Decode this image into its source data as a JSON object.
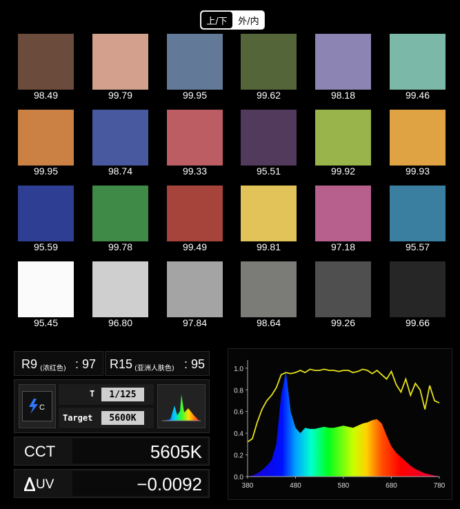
{
  "toggle": {
    "option1": "上/下",
    "option2": "外/内"
  },
  "swatches": [
    {
      "color": "#6a4b3c",
      "value": "98.49"
    },
    {
      "color": "#d4a08e",
      "value": "99.79"
    },
    {
      "color": "#627a98",
      "value": "99.95"
    },
    {
      "color": "#55653a",
      "value": "99.62"
    },
    {
      "color": "#8c84b2",
      "value": "98.18"
    },
    {
      "color": "#7cb8a8",
      "value": "99.46"
    },
    {
      "color": "#cb8143",
      "value": "99.95"
    },
    {
      "color": "#4959a0",
      "value": "98.74"
    },
    {
      "color": "#bc5d64",
      "value": "99.33"
    },
    {
      "color": "#523a5d",
      "value": "95.51"
    },
    {
      "color": "#98b44b",
      "value": "99.92"
    },
    {
      "color": "#e0a343",
      "value": "99.93"
    },
    {
      "color": "#2e3e92",
      "value": "95.59"
    },
    {
      "color": "#3f8a46",
      "value": "99.78"
    },
    {
      "color": "#a6433b",
      "value": "99.49"
    },
    {
      "color": "#e2c35a",
      "value": "99.81"
    },
    {
      "color": "#b7608e",
      "value": "97.18"
    },
    {
      "color": "#3a7ea0",
      "value": "95.57"
    },
    {
      "color": "#fbfbfb",
      "value": "95.45"
    },
    {
      "color": "#cfcfcf",
      "value": "96.80"
    },
    {
      "color": "#a4a4a4",
      "value": "97.84"
    },
    {
      "color": "#7b7b78",
      "value": "98.64"
    },
    {
      "color": "#4f4f4f",
      "value": "99.26"
    },
    {
      "color": "#262626",
      "value": "99.66"
    }
  ],
  "metrics": {
    "r9_label": "R9",
    "r9_sub": "(浓红色)",
    "r9_value": ": 97",
    "r15_label": "R15",
    "r15_sub": "(亚洲人肤色)",
    "r15_value": ": 95",
    "t_label": "T",
    "t_value": "1/125",
    "target_label": "Target",
    "target_value": "5600K",
    "cct_label": "CCT",
    "cct_value": "5605K",
    "duv_label": "UV",
    "duv_value": "−0.0092",
    "flash_letter": "C"
  },
  "chart_data": {
    "type": "line",
    "x": [
      380,
      390,
      400,
      410,
      420,
      430,
      440,
      450,
      460,
      470,
      480,
      490,
      500,
      510,
      520,
      530,
      540,
      550,
      560,
      570,
      580,
      590,
      600,
      610,
      620,
      630,
      640,
      650,
      660,
      670,
      680,
      690,
      700,
      710,
      720,
      730,
      740,
      750,
      760,
      770,
      780
    ],
    "series": [
      {
        "values": [
          0.32,
          0.35,
          0.5,
          0.62,
          0.7,
          0.75,
          0.82,
          0.94,
          0.96,
          0.95,
          0.96,
          0.98,
          0.96,
          0.99,
          0.98,
          0.98,
          0.99,
          0.98,
          0.98,
          0.97,
          0.98,
          0.98,
          0.96,
          0.97,
          0.99,
          0.98,
          0.95,
          0.98,
          0.94,
          0.9,
          0.97,
          0.85,
          0.78,
          0.9,
          0.75,
          0.86,
          0.8,
          0.62,
          0.84,
          0.7,
          0.68
        ]
      },
      {
        "values": [
          0.0,
          0.01,
          0.03,
          0.06,
          0.1,
          0.15,
          0.3,
          0.75,
          0.97,
          0.6,
          0.45,
          0.4,
          0.45,
          0.44,
          0.44,
          0.45,
          0.46,
          0.45,
          0.45,
          0.46,
          0.47,
          0.46,
          0.45,
          0.47,
          0.49,
          0.5,
          0.52,
          0.53,
          0.49,
          0.38,
          0.28,
          0.22,
          0.18,
          0.14,
          0.1,
          0.07,
          0.05,
          0.03,
          0.02,
          0.01,
          0.0
        ]
      }
    ],
    "xticks": [
      380,
      480,
      580,
      680,
      780
    ],
    "yticks": [
      "0.0",
      "0.2",
      "0.4",
      "0.6",
      "0.8",
      "1.0"
    ],
    "xlim": [
      380,
      780
    ],
    "ylim": [
      0,
      1.05
    ],
    "grid": false
  }
}
